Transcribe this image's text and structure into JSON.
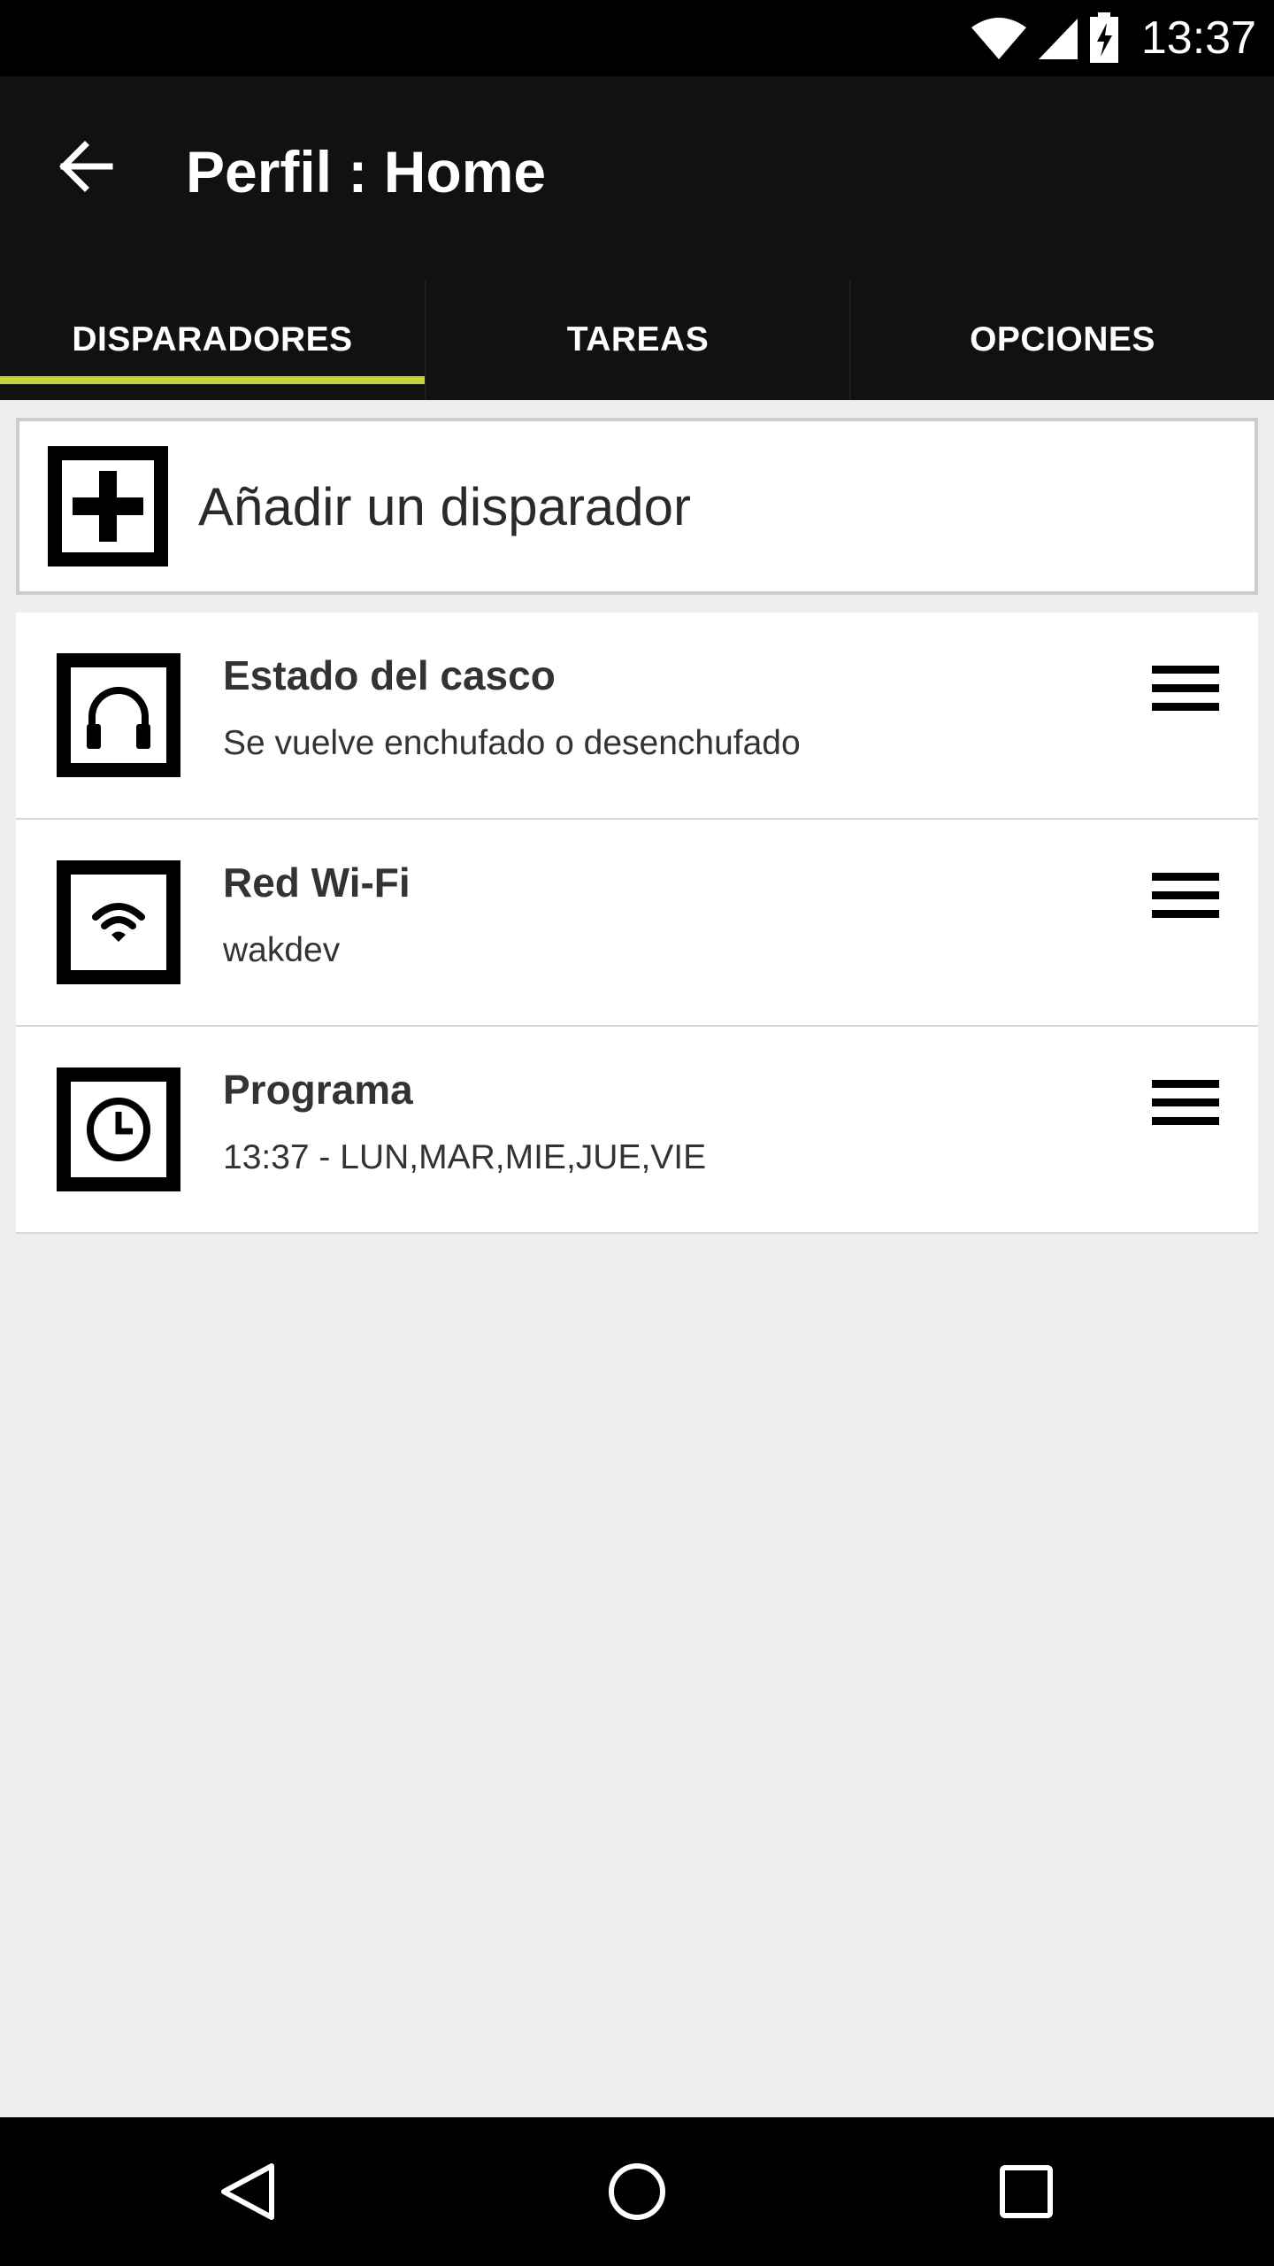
{
  "status_bar": {
    "time": "13:37",
    "icons": [
      "wifi-signal-icon",
      "cell-signal-icon",
      "battery-charging-icon"
    ]
  },
  "app_bar": {
    "title": "Perfil : Home",
    "back_icon": "arrow-back-icon"
  },
  "tabs": [
    {
      "label": "DISPARADORES",
      "selected": true
    },
    {
      "label": "TAREAS",
      "selected": false
    },
    {
      "label": "OPCIONES",
      "selected": false
    }
  ],
  "add_trigger": {
    "label": "Añadir un disparador",
    "icon": "plus-icon"
  },
  "triggers": [
    {
      "title": "Estado del casco",
      "subtitle": "Se vuelve enchufado o desenchufado",
      "icon": "headphones-icon"
    },
    {
      "title": "Red Wi-Fi",
      "subtitle": "wakdev",
      "icon": "wifi-icon"
    },
    {
      "title": "Programa",
      "subtitle": "13:37 - LUN,MAR,MIE,JUE,VIE",
      "icon": "clock-icon"
    }
  ],
  "nav_bar": {
    "icons": [
      "back-triangle-icon",
      "home-circle-icon",
      "recents-square-icon"
    ]
  },
  "colors": {
    "accent": "#c6d23a",
    "app_bar": "#111111",
    "background": "#eeeeee",
    "card": "#ffffff"
  }
}
